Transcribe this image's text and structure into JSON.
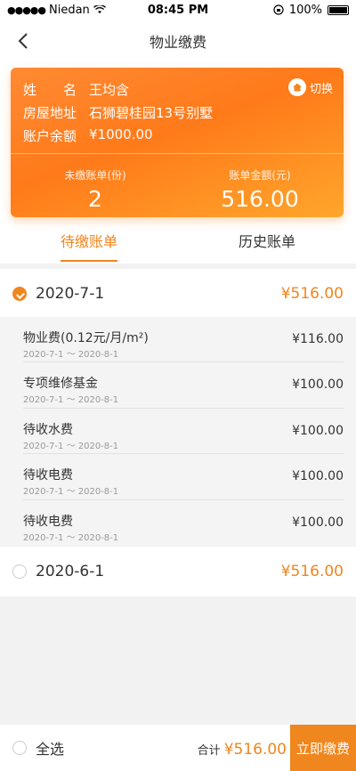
{
  "status": {
    "carrier": "Niedan",
    "time": "08:45 PM",
    "battery": "100%"
  },
  "nav": {
    "title": "物业缴费"
  },
  "card": {
    "name_label": "姓　　名",
    "name": "王均含",
    "address_label": "房屋地址",
    "address": "石狮碧桂园13号别墅",
    "balance_label": "账户余额",
    "balance": "¥1000.00",
    "switch_label": "切换",
    "unpaid_label": "未缴账单(份)",
    "unpaid_count": "2",
    "amount_label": "账单金额(元)",
    "amount": "516.00"
  },
  "tabs": [
    {
      "label": "待缴账单"
    },
    {
      "label": "历史账单"
    }
  ],
  "groups": [
    {
      "date": "2020-7-1",
      "amount": "¥516.00",
      "checked": true,
      "items": [
        {
          "name": "物业费(0.12元/月/m²)",
          "range": "2020-7-1 ～ 2020-8-1",
          "amount": "¥116.00"
        },
        {
          "name": "专项维修基金",
          "range": "2020-7-1 ～ 2020-8-1",
          "amount": "¥100.00"
        },
        {
          "name": "待收水费",
          "range": "2020-7-1 ～ 2020-8-1",
          "amount": "¥100.00"
        },
        {
          "name": "待收电费",
          "range": "2020-7-1 ～ 2020-8-1",
          "amount": "¥100.00"
        },
        {
          "name": "待收电费",
          "range": "2020-7-1 ～ 2020-8-1",
          "amount": "¥100.00"
        }
      ]
    },
    {
      "date": "2020-6-1",
      "amount": "¥516.00",
      "checked": false
    }
  ],
  "bottom": {
    "select_all": "全选",
    "total_label": "合计",
    "total": "¥516.00",
    "pay": "立即缴费"
  },
  "colors": {
    "accent": "#f0861e"
  }
}
